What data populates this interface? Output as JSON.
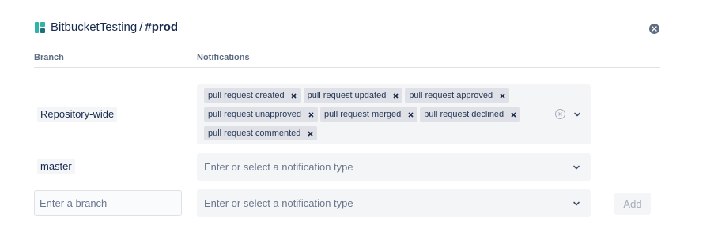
{
  "header": {
    "workspace": "BitbucketTesting",
    "separator": "/",
    "channel": "#prod"
  },
  "columns": {
    "branch": "Branch",
    "notifications": "Notifications"
  },
  "rows": [
    {
      "branch": "Repository-wide",
      "chips": [
        "pull request created",
        "pull request updated",
        "pull request approved",
        "pull request unapproved",
        "pull request merged",
        "pull request declined",
        "pull request commented"
      ]
    },
    {
      "branch": "master",
      "placeholder": "Enter or select a notification type"
    }
  ],
  "new_row": {
    "branch_placeholder": "Enter a branch",
    "notification_placeholder": "Enter or select a notification type",
    "add_label": "Add"
  },
  "colors": {
    "logo_teal": "#2fb5a8",
    "logo_dark": "#1e6f7a",
    "chip_bg": "#dfe1e6",
    "field_bg": "#f4f5f7"
  }
}
